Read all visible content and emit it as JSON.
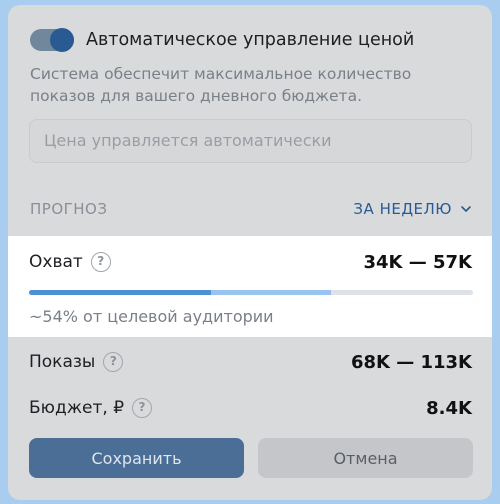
{
  "auto_price": {
    "label": "Автоматическое управление ценой",
    "enabled": true,
    "description": "Система обеспечит максимальное количество показов для вашего дневного бюджета."
  },
  "price_input": {
    "placeholder": "Цена управляется автоматически"
  },
  "forecast": {
    "title": "ПРОГНОЗ",
    "period_label": "ЗА НЕДЕЛЮ",
    "reach": {
      "label": "Охват",
      "value": "34K — 57K",
      "progress_min": 0.41,
      "progress_max": 0.68,
      "audience_note": "~54% от целевой аудитории"
    },
    "impressions": {
      "label": "Показы",
      "value": "68K — 113K"
    },
    "budget": {
      "label": "Бюджет, ₽",
      "value": "8.4K"
    }
  },
  "buttons": {
    "save": "Сохранить",
    "cancel": "Отмена"
  },
  "colors": {
    "accent": "#2a5a92",
    "progress": "#4e90d8",
    "progress_range": "#99c4ef"
  }
}
